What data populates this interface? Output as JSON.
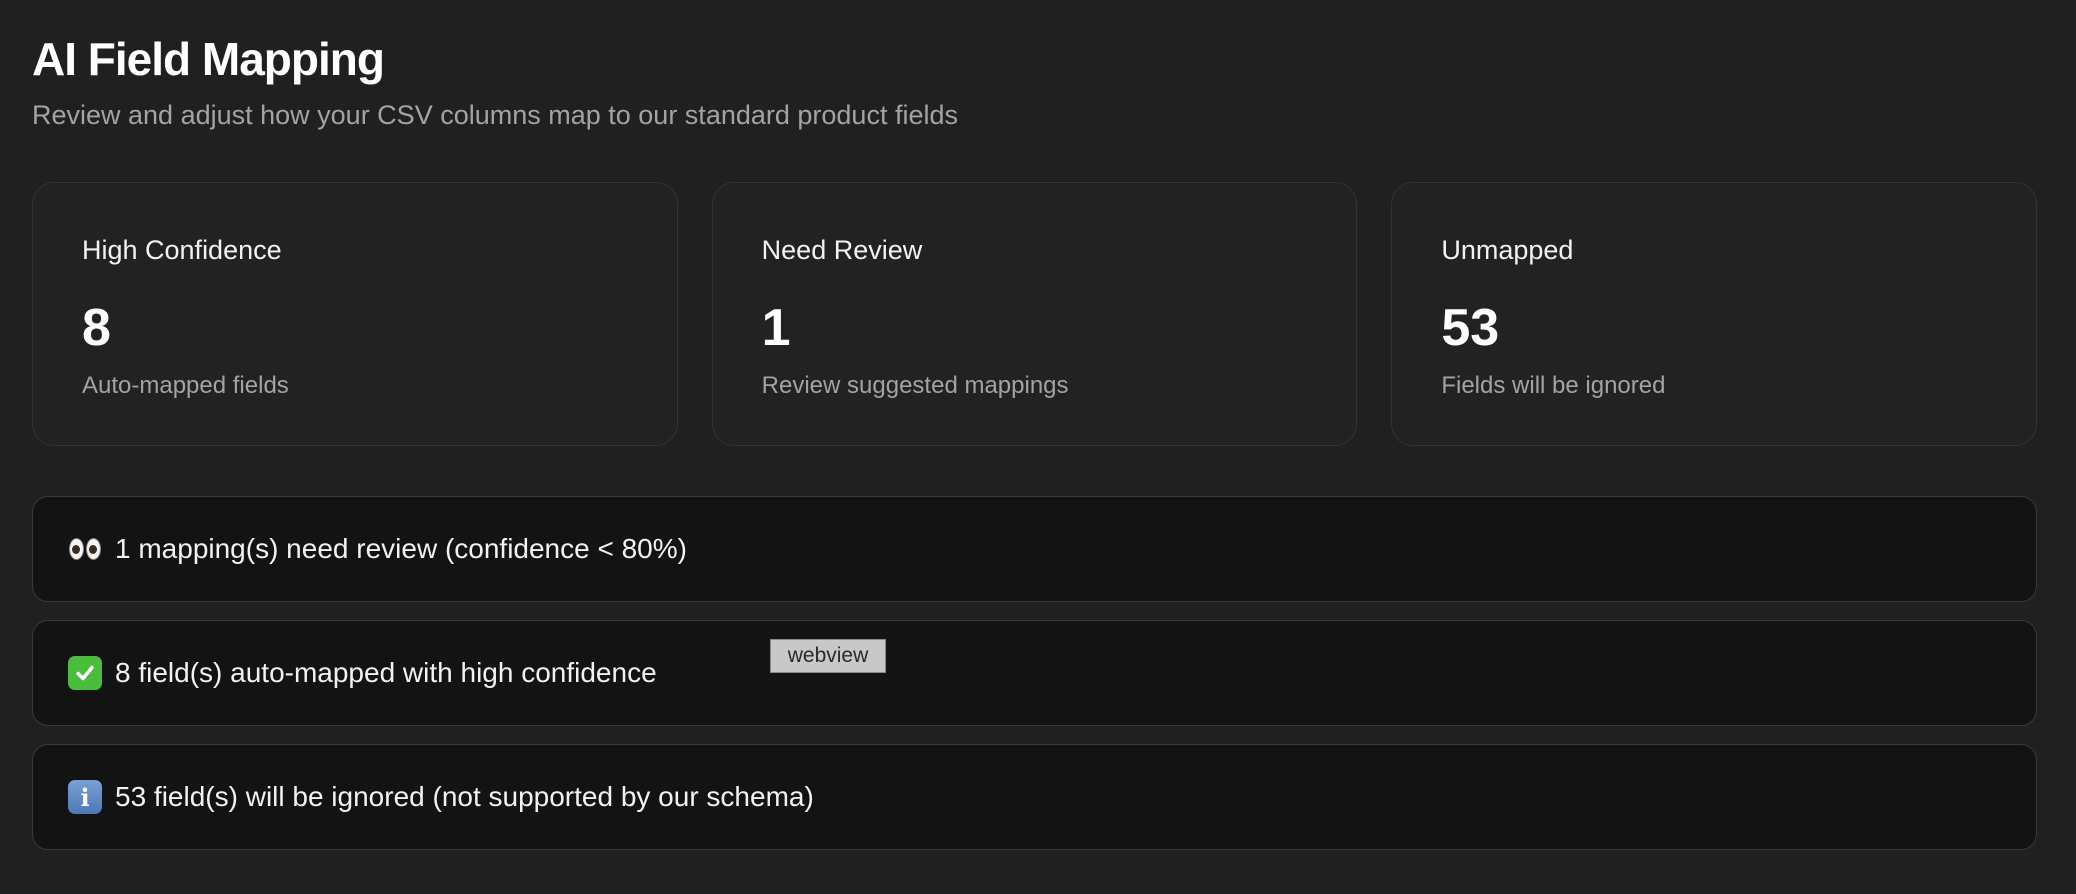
{
  "header": {
    "title": "AI Field Mapping",
    "subtitle": "Review and adjust how your CSV columns map to our standard product fields"
  },
  "stats": [
    {
      "title": "High Confidence",
      "value": "8",
      "description": "Auto-mapped fields"
    },
    {
      "title": "Need Review",
      "value": "1",
      "description": "Review suggested mappings"
    },
    {
      "title": "Unmapped",
      "value": "53",
      "description": "Fields will be ignored"
    }
  ],
  "alerts": [
    {
      "icon": "eyes-icon",
      "text": "1 mapping(s) need review (confidence < 80%)"
    },
    {
      "icon": "check-mark-icon",
      "text": "8 field(s) auto-mapped with high confidence"
    },
    {
      "icon": "info-icon",
      "text": "53 field(s) will be ignored (not supported by our schema)"
    }
  ],
  "overlay": {
    "webview_label": "webview"
  },
  "colors": {
    "background": "#202020",
    "card_background": "#222222",
    "alert_background": "#131313",
    "check_green": "#4bbd3c",
    "info_blue": "#4d78b5",
    "muted_text": "#a3a3a3"
  }
}
